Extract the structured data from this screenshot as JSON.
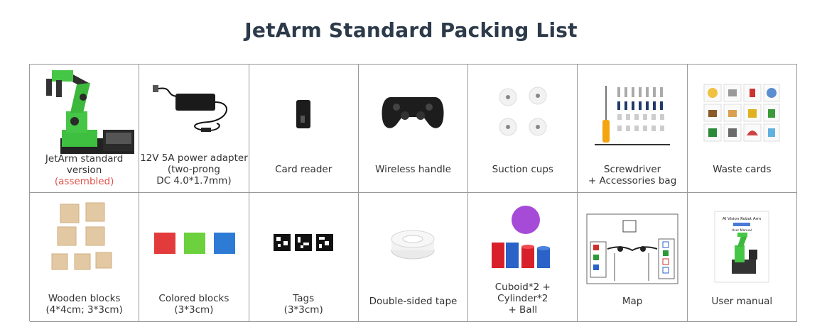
{
  "page": {
    "title": "JetArm Standard Packing List"
  },
  "items": [
    {
      "icon": "robot-arm-icon",
      "lines": [
        "JetArm standard version"
      ],
      "note": "(assembled)"
    },
    {
      "icon": "power-adapter-icon",
      "lines": [
        "12V 5A power adapter",
        "(two-prong",
        "DC 4.0*1.7mm)"
      ]
    },
    {
      "icon": "card-reader-icon",
      "lines": [
        "Card reader"
      ]
    },
    {
      "icon": "gamepad-icon",
      "lines": [
        "Wireless handle"
      ]
    },
    {
      "icon": "suction-cup-icon",
      "lines": [
        "Suction cups"
      ]
    },
    {
      "icon": "screwdriver-icon",
      "lines": [
        "Screwdriver",
        "+ Accessories bag"
      ]
    },
    {
      "icon": "waste-cards-icon",
      "lines": [
        "Waste cards"
      ]
    },
    {
      "icon": "wooden-blocks-icon",
      "lines": [
        "Wooden blocks",
        "(4*4cm; 3*3cm)"
      ]
    },
    {
      "icon": "colored-blocks-icon",
      "lines": [
        "Colored blocks",
        "(3*3cm)"
      ]
    },
    {
      "icon": "tags-icon",
      "lines": [
        "Tags",
        "(3*3cm)"
      ]
    },
    {
      "icon": "tape-icon",
      "lines": [
        "Double-sided tape"
      ]
    },
    {
      "icon": "cuboid-cylinder-ball-icon",
      "lines": [
        "Cuboid*2 + Cylinder*2",
        "+ Ball"
      ]
    },
    {
      "icon": "map-icon",
      "lines": [
        "Map"
      ]
    },
    {
      "icon": "user-manual-icon",
      "lines": [
        "User manual"
      ],
      "manual_text": [
        "AI Vision Robot Arm",
        "User Manual"
      ]
    }
  ]
}
